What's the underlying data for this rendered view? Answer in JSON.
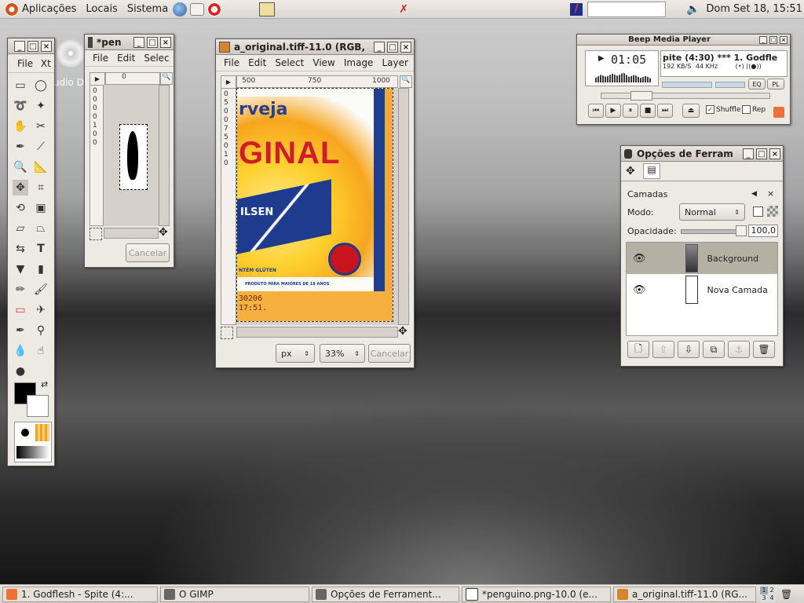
{
  "topbar": {
    "menus": [
      "Aplicações",
      "Locais",
      "Sistema"
    ],
    "clock": "Dom Set 18, 15:51"
  },
  "desktop": {
    "icon_label": "udio D"
  },
  "toolbox": {
    "tools": [
      "rect-select",
      "ellipse-select",
      "free-select",
      "fuzzy-select",
      "color-select",
      "scissors",
      "paths",
      "color-picker",
      "zoom",
      "measure",
      "move",
      "crop",
      "rotate",
      "scale",
      "shear",
      "perspective",
      "flip",
      "text",
      "bucket-fill",
      "blend",
      "pencil",
      "paintbrush",
      "eraser",
      "airbrush",
      "ink",
      "clone",
      "blur",
      "smudge",
      "dodge-burn"
    ]
  },
  "pen_window": {
    "title": "*pen",
    "menus": [
      "File",
      "Edit",
      "Selec"
    ],
    "ruler_top": "0",
    "ruler_left": [
      "0",
      "0",
      "0",
      "0",
      "1",
      "0",
      "0"
    ],
    "cancel": "Cancelar"
  },
  "image_window": {
    "title": "a_original.tiff-11.0 (RGB,",
    "menus": [
      "File",
      "Edit",
      "Select",
      "View",
      "Image",
      "Layer"
    ],
    "ruler_top": [
      "500",
      "750",
      "1000"
    ],
    "ruler_left": [
      "0",
      "5",
      "0",
      "0",
      "7",
      "5",
      "0",
      "1",
      "0"
    ],
    "unit": "px",
    "zoom": "33%",
    "cancel": "Cancelar",
    "label_text": {
      "t1": "rveja",
      "t2": "GINAL",
      "t3": "ILSEN",
      "t4": "NTÉM GLÚTEN",
      "t5": "PRODUTO PARA MAIORES DE 18 ANOS",
      "t6": "30206",
      "t7": "17:51."
    }
  },
  "media_player": {
    "title": "Beep Media Player",
    "time": "01:05",
    "track": "pite (4:30) *** 1. Godfle",
    "bitrate": "192 KB/S",
    "frequency": "44 KHz",
    "eq": "EQ",
    "pl": "PL",
    "shuffle": "Shuffle",
    "repeat": "Rep"
  },
  "layers_dialog": {
    "title": "Opções de Ferram",
    "section": "Camadas",
    "mode_label": "Modo:",
    "mode_value": "Normal",
    "opacity_label": "Opacidade:",
    "opacity_value": "100,0",
    "layers": [
      "Background",
      "Nova Camada"
    ]
  },
  "taskbar": {
    "items": [
      "1. Godflesh - Spite (4:...",
      "O GIMP",
      "Opções de Ferrament...",
      "*penguino.png-10.0 (e...",
      "a_original.tiff-11.0 (RG..."
    ],
    "workspaces": [
      "1",
      "2",
      "3",
      "4"
    ]
  }
}
